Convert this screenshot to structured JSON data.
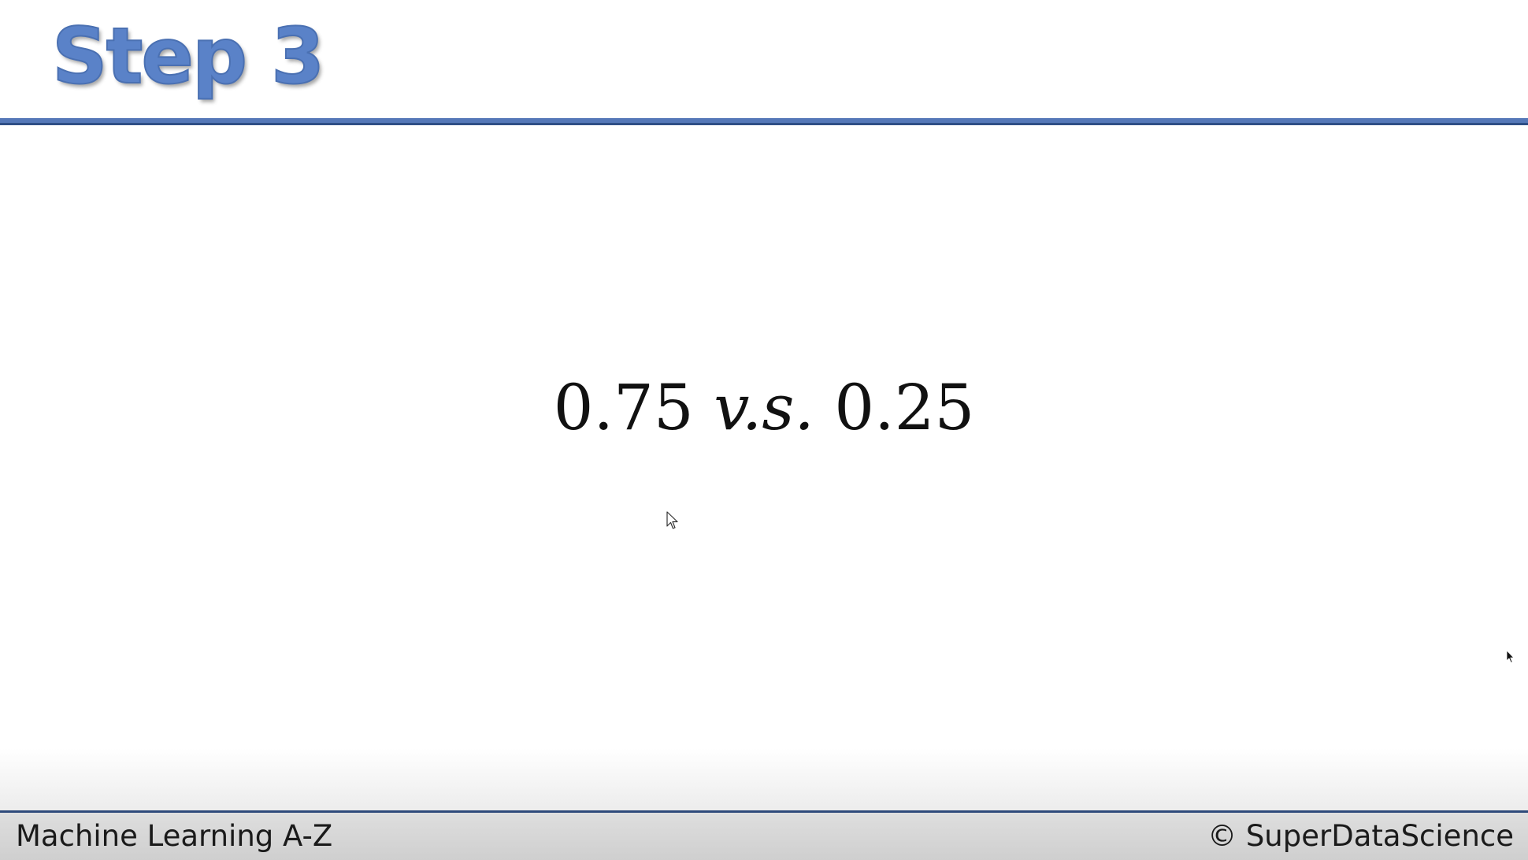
{
  "slide": {
    "title": "Step 3",
    "formula": {
      "left_value": "0.75",
      "operator": "v.s.",
      "right_value": "0.25"
    }
  },
  "footer": {
    "left_text": "Machine Learning A-Z",
    "right_text": "© SuperDataScience"
  },
  "colors": {
    "title": "#5a82c8",
    "rule": "#5578b8",
    "footer_rule": "#2e4a7a",
    "text": "#111111"
  },
  "icons": {
    "pointer": "mouse-pointer-icon",
    "pointer_right": "mouse-pointer-icon"
  }
}
